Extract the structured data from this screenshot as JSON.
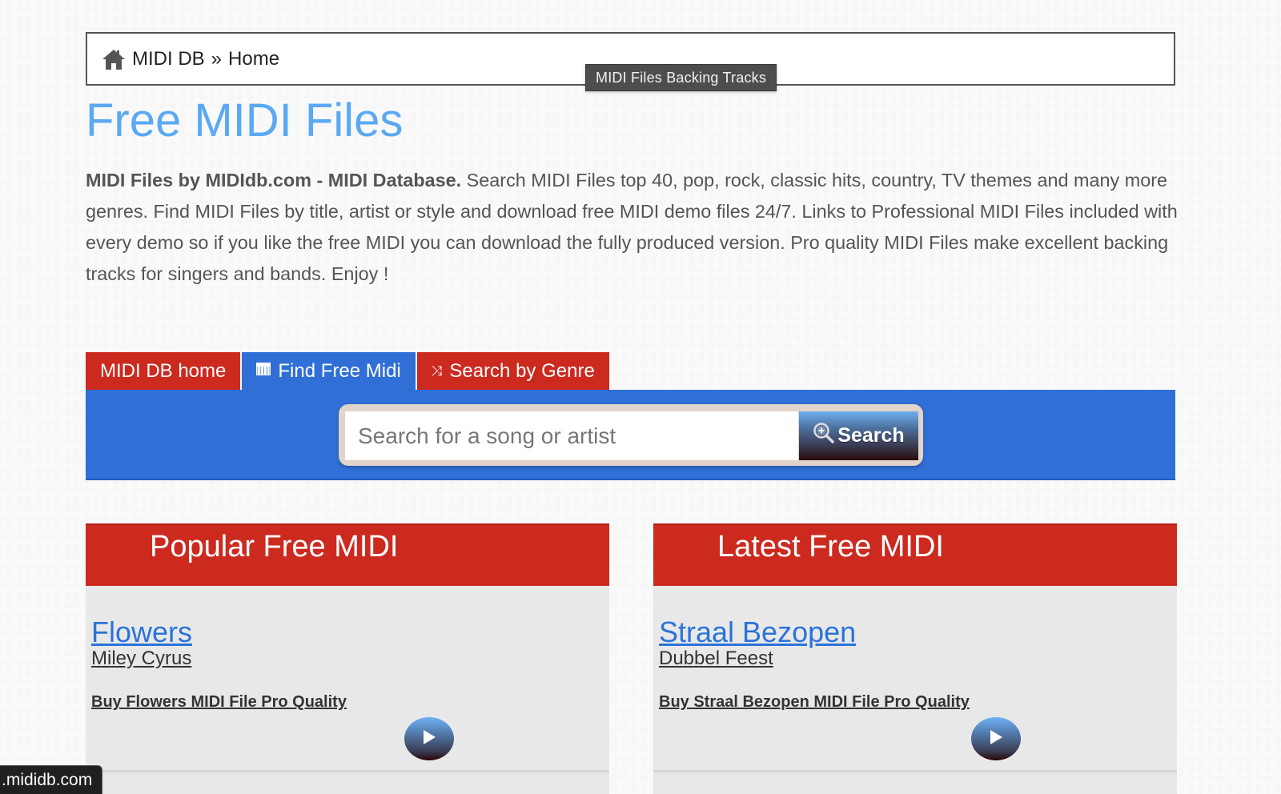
{
  "breadcrumb": {
    "home_icon": "home-icon",
    "site": "MIDI DB",
    "separator": "»",
    "current": "Home"
  },
  "tooltip": "MIDI Files Backing Tracks",
  "page_title": "Free MIDI Files",
  "intro": {
    "bold": "MIDI Files by MIDIdb.com - MIDI Database.",
    "text": " Search MIDI Files top 40, pop, rock, classic hits, country, TV themes and many more genres. Find MIDI Files by title, artist or style and download free MIDI demo files 24/7. Links to Professional MIDI Files included with every demo so if you like the free MIDI you can download the fully produced version. Pro quality MIDI Files make excellent backing tracks for singers and bands. Enjoy !"
  },
  "tabs": [
    {
      "label": "MIDI DB home",
      "icon": "",
      "active": false
    },
    {
      "label": "Find Free Midi",
      "icon": "piano-keys-icon",
      "active": true
    },
    {
      "label": "Search by Genre",
      "icon": "shuffle-icon",
      "active": false
    }
  ],
  "search": {
    "placeholder": "Search for a song or artist",
    "value": "",
    "button_label": "Search",
    "button_icon": "zoom-in-icon"
  },
  "panels": [
    {
      "header": "Popular Free MIDI",
      "song": "Flowers",
      "artist": "Miley Cyrus",
      "buy_label": "Buy Flowers MIDI File Pro Quality",
      "play_icon": "play-icon"
    },
    {
      "header": "Latest Free MIDI",
      "song": "Straal Bezopen",
      "artist": "Dubbel Feest",
      "buy_label": "Buy Straal Bezopen MIDI File Pro Quality",
      "play_icon": "play-icon"
    }
  ],
  "status_url": ".mididb.com",
  "colors": {
    "title_blue": "#5aa9f2",
    "tab_red": "#cc2a1f",
    "tab_blue": "#2f6fd6",
    "link_blue": "#2a73d9"
  }
}
